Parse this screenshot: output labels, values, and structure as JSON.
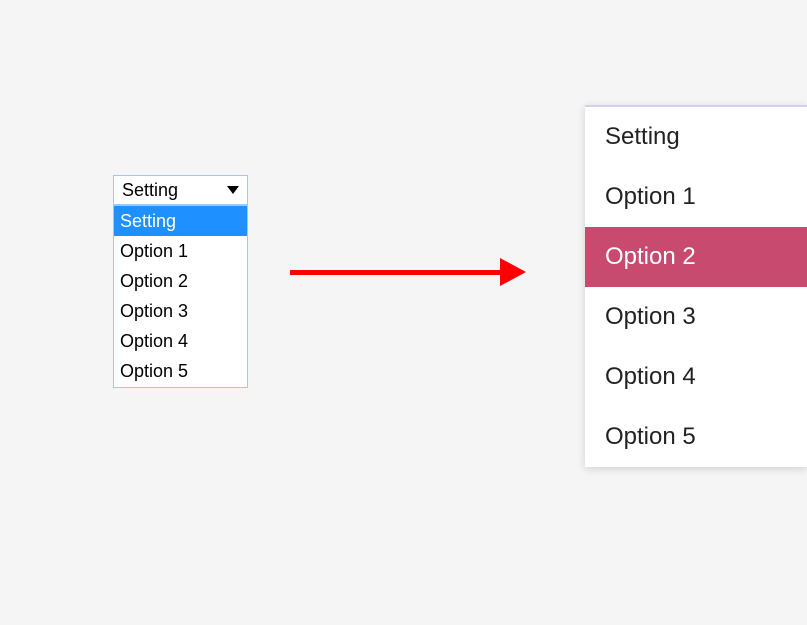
{
  "native": {
    "selected": "Setting",
    "options": {
      "0": "Setting",
      "1": "Option 1",
      "2": "Option 2",
      "3": "Option 3",
      "4": "Option 4",
      "5": "Option 5"
    },
    "highlighted_index": 0
  },
  "styled": {
    "options": {
      "0": "Setting",
      "1": "Option 1",
      "2": "Option 2",
      "3": "Option 3",
      "4": "Option 4",
      "5": "Option 5"
    },
    "highlighted_index": 2
  },
  "colors": {
    "native_highlight": "#1e90ff",
    "styled_highlight": "#c94a6f",
    "arrow": "#ff0000"
  }
}
